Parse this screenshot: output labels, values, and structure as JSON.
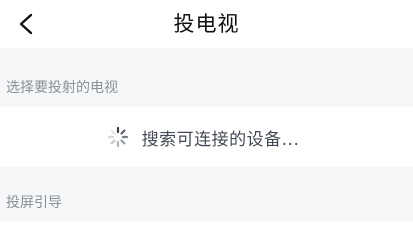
{
  "header": {
    "title": "投电视",
    "back_icon": "chevron-left-icon"
  },
  "sections": [
    {
      "label": "选择要投射的电视"
    },
    {
      "label": "投屏引导"
    }
  ],
  "search": {
    "status_text": "搜索可连接的设备...",
    "spinner_icon": "loading-spinner-icon"
  }
}
